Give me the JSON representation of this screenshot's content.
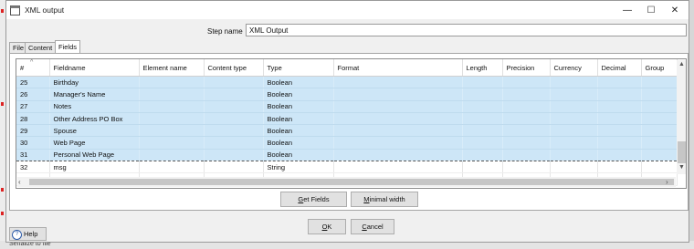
{
  "window": {
    "title": "XML output",
    "minimize_glyph": "—",
    "maximize_glyph": "☐",
    "close_glyph": "✕"
  },
  "step": {
    "label": "Step name",
    "value": "XML Output"
  },
  "tabs": [
    {
      "label": "File"
    },
    {
      "label": "Content"
    },
    {
      "label": "Fields"
    }
  ],
  "table": {
    "columns": [
      "#",
      "Fieldname",
      "Element name",
      "Content type",
      "Type",
      "Format",
      "Length",
      "Precision",
      "Currency",
      "Decimal",
      "Group"
    ],
    "sort_glyph": "^",
    "rows": [
      {
        "num": "25",
        "fieldname": "Birthday",
        "element": "",
        "content": "",
        "type": "Boolean",
        "format": "",
        "length": "",
        "precision": "",
        "currency": "",
        "decimal": "",
        "group": "",
        "selected": true
      },
      {
        "num": "26",
        "fieldname": "Manager's Name",
        "element": "",
        "content": "",
        "type": "Boolean",
        "format": "",
        "length": "",
        "precision": "",
        "currency": "",
        "decimal": "",
        "group": "",
        "selected": true
      },
      {
        "num": "27",
        "fieldname": "Notes",
        "element": "",
        "content": "",
        "type": "Boolean",
        "format": "",
        "length": "",
        "precision": "",
        "currency": "",
        "decimal": "",
        "group": "",
        "selected": true
      },
      {
        "num": "28",
        "fieldname": "Other Address PO Box",
        "element": "",
        "content": "",
        "type": "Boolean",
        "format": "",
        "length": "",
        "precision": "",
        "currency": "",
        "decimal": "",
        "group": "",
        "selected": true
      },
      {
        "num": "29",
        "fieldname": "Spouse",
        "element": "",
        "content": "",
        "type": "Boolean",
        "format": "",
        "length": "",
        "precision": "",
        "currency": "",
        "decimal": "",
        "group": "",
        "selected": true
      },
      {
        "num": "30",
        "fieldname": "Web Page",
        "element": "",
        "content": "",
        "type": "Boolean",
        "format": "",
        "length": "",
        "precision": "",
        "currency": "",
        "decimal": "",
        "group": "",
        "selected": true
      },
      {
        "num": "31",
        "fieldname": "Personal Web Page",
        "element": "",
        "content": "",
        "type": "Boolean",
        "format": "",
        "length": "",
        "precision": "",
        "currency": "",
        "decimal": "",
        "group": "",
        "selected": true,
        "focused": true
      },
      {
        "num": "32",
        "fieldname": "msg",
        "element": "",
        "content": "",
        "type": "String",
        "format": "",
        "length": "",
        "precision": "",
        "currency": "",
        "decimal": "",
        "group": "",
        "selected": false
      },
      {
        "num": "",
        "fieldname": "",
        "element": "",
        "content": "",
        "type": "",
        "format": "",
        "length": "",
        "precision": "",
        "currency": "",
        "decimal": "",
        "group": "",
        "selected": false
      }
    ]
  },
  "scroll": {
    "up": "▲",
    "down": "▼",
    "left": "‹",
    "right": "›"
  },
  "buttons": {
    "get_fields": {
      "accel": "G",
      "rest": "et Fields"
    },
    "minimal_width": {
      "accel": "M",
      "rest": "inimal width"
    },
    "ok": {
      "accel": "O",
      "rest": "K"
    },
    "cancel": {
      "accel": "C",
      "rest": "ancel"
    },
    "help": "Help",
    "help_icon": "?"
  },
  "background": {
    "serialize_text": "Serialize to file"
  },
  "colors": {
    "selection": "#cde6f7",
    "window_bg": "#f0f0f0"
  }
}
